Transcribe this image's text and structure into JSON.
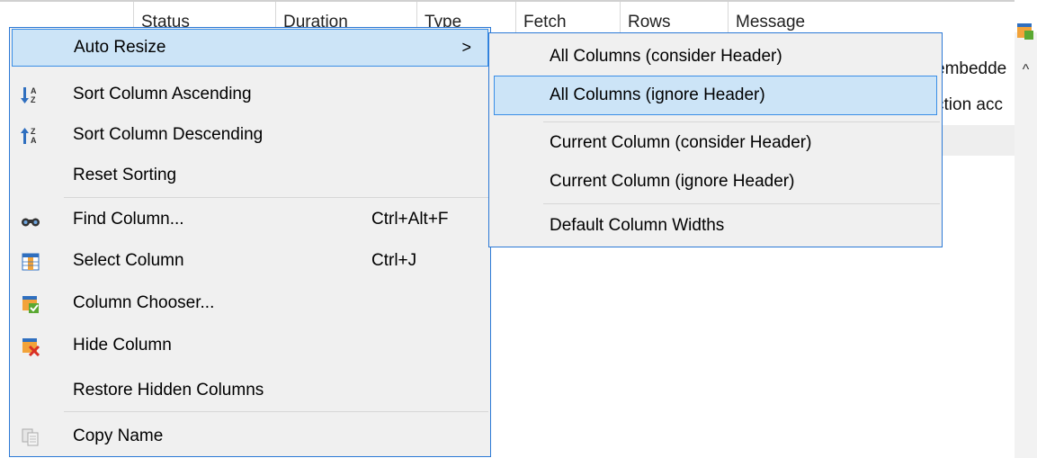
{
  "grid": {
    "headers": [
      "Status",
      "Duration",
      "Type",
      "Fetch",
      "Rows",
      "Message"
    ],
    "rows": [
      {
        "message_fragment": "embedde"
      },
      {
        "message_fragment": "ction acc"
      }
    ]
  },
  "scrollbar": {
    "up_arrow": "^"
  },
  "main_menu": {
    "items": [
      {
        "label": "Auto Resize",
        "submenu_arrow": ">",
        "icon": ""
      },
      {
        "label": "Sort Column Ascending",
        "icon": "sort-ascending-icon"
      },
      {
        "label": "Sort Column Descending",
        "icon": "sort-descending-icon"
      },
      {
        "label": "Reset Sorting",
        "icon": ""
      },
      {
        "label": "Find Column...",
        "shortcut": "Ctrl+Alt+F",
        "icon": "binoculars-icon"
      },
      {
        "label": "Select Column",
        "shortcut": "Ctrl+J",
        "icon": "select-column-icon"
      },
      {
        "label": "Column Chooser...",
        "icon": "column-chooser-icon"
      },
      {
        "label": "Hide Column",
        "icon": "hide-column-icon"
      },
      {
        "label": "Restore Hidden Columns",
        "icon": ""
      },
      {
        "label": "Copy Name",
        "icon": "copy-icon"
      }
    ]
  },
  "sub_menu": {
    "items": [
      {
        "label": "All Columns (consider Header)"
      },
      {
        "label": "All Columns (ignore Header)"
      },
      {
        "label": "Current Column (consider Header)"
      },
      {
        "label": "Current Column (ignore Header)"
      },
      {
        "label": "Default Column Widths"
      }
    ]
  },
  "colors": {
    "menu_bg": "#f0f0f0",
    "menu_border": "#2b79d6",
    "highlight_bg": "#cce4f7",
    "highlight_border": "#3a8ee6",
    "icon_blue": "#2f6fbf",
    "icon_green": "#5aa832",
    "icon_red": "#d93025",
    "icon_orange": "#f2a33a"
  }
}
